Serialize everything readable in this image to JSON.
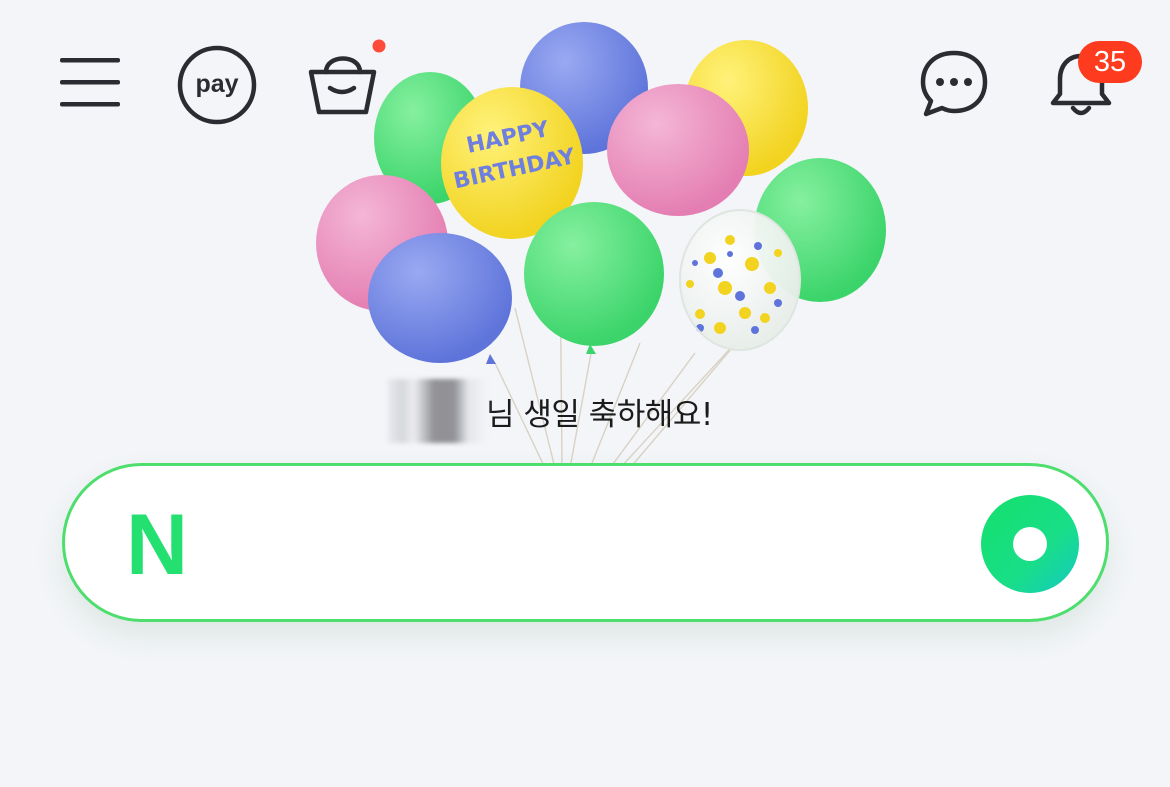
{
  "header": {
    "menu_icon": "hamburger-menu-icon",
    "pay_label": "pay",
    "shopping_icon": "shopping-bag-icon",
    "talk_icon": "chat-bubble-icon",
    "notification_icon": "bell-icon",
    "notification_count": "35"
  },
  "greeting": {
    "suffix": "님 생일 축하해요!"
  },
  "balloon_art": {
    "label_line1": "HAPPY",
    "label_line2": "BIRTHDAY"
  },
  "search": {
    "logo_letter": "N",
    "value": "",
    "placeholder": "",
    "lens_icon": "green-lens-icon"
  },
  "colors": {
    "brand_green": "#03c75a",
    "border_green": "#4ede6e",
    "badge_red": "#ff3b1f",
    "shop_dot": "#ff4b3a",
    "icon_dark": "#2a2c31",
    "background": "#f3f5f8"
  }
}
